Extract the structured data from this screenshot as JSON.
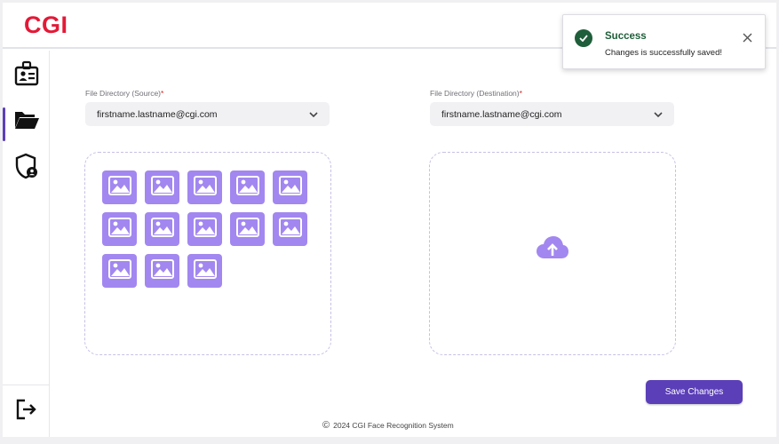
{
  "app": {
    "logo": "CGI"
  },
  "sidebar": {
    "items": [
      {
        "icon": "id-badge-icon",
        "active": false
      },
      {
        "icon": "folder-open-icon",
        "active": true
      },
      {
        "icon": "shield-user-icon",
        "active": false
      }
    ],
    "logout_icon": "logout-icon"
  },
  "source": {
    "label": "File Directory (Source)",
    "required_mark": "*",
    "value": "firstname.lastname@cgi.com",
    "image_count": 13
  },
  "destination": {
    "label": "File Directory (Destination)",
    "required_mark": "*",
    "value": "firstname.lastname@cgi.com"
  },
  "actions": {
    "save_label": "Save Changes"
  },
  "footer": {
    "copyright_symbol": "©",
    "text": "2024 CGI Face Recognition System"
  },
  "toast": {
    "title": "Success",
    "message": "Changes is successfully  saved!"
  },
  "colors": {
    "brand": "#e31937",
    "accent": "#5b3fb8",
    "thumb": "#a287f0",
    "success": "#1f5e3a"
  }
}
